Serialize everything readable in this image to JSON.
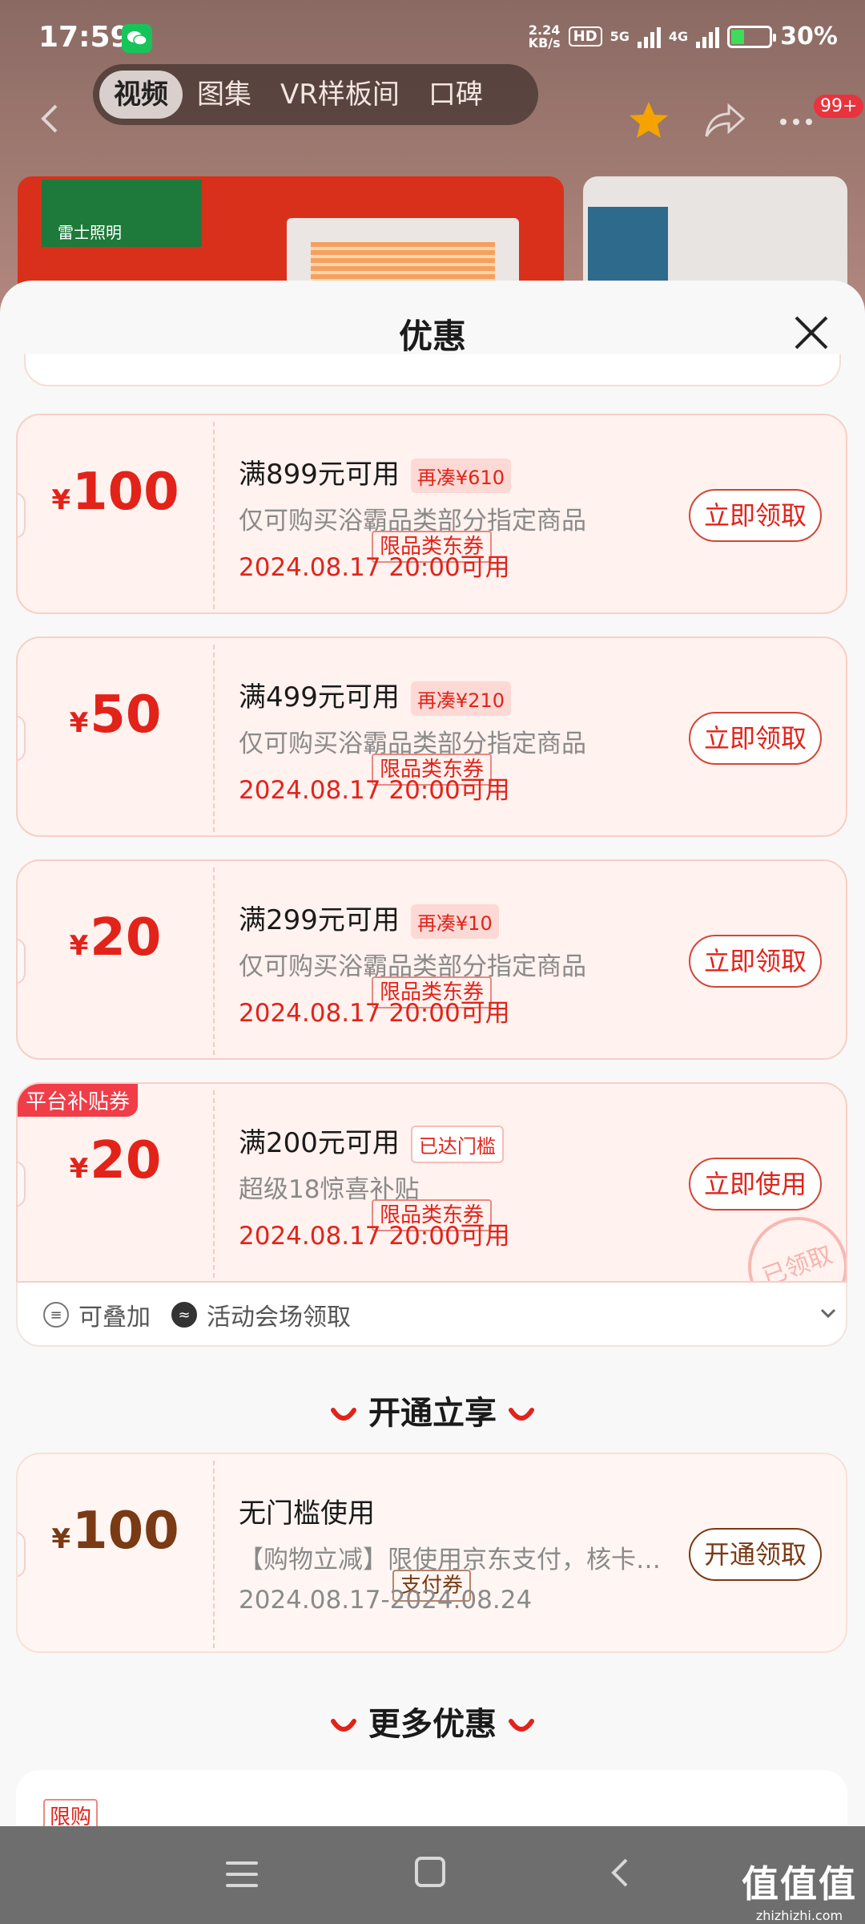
{
  "status_bar": {
    "time": "17:59",
    "net_speed": "2.24",
    "net_unit": "KB/s",
    "hd": "HD",
    "sig1": "5G",
    "sig2": "4G",
    "battery": "30%"
  },
  "header": {
    "tabs": [
      "视频",
      "图集",
      "VR样板间",
      "口碑"
    ],
    "active_tab": 0,
    "badge": "99+"
  },
  "banner": {
    "brand": "雷士照明"
  },
  "sheet": {
    "title": "优惠"
  },
  "coupons": [
    {
      "amount": "100",
      "currency": "¥",
      "type": "限品类东券",
      "title": "满899元可用",
      "badge": "再凑¥610",
      "desc": "仅可购买浴霸品类部分指定商品",
      "date": "2024.08.17 20:00可用",
      "button": "立即领取"
    },
    {
      "amount": "50",
      "currency": "¥",
      "type": "限品类东券",
      "title": "满499元可用",
      "badge": "再凑¥210",
      "desc": "仅可购买浴霸品类部分指定商品",
      "date": "2024.08.17 20:00可用",
      "button": "立即领取"
    },
    {
      "amount": "20",
      "currency": "¥",
      "type": "限品类东券",
      "title": "满299元可用",
      "badge": "再凑¥10",
      "desc": "仅可购买浴霸品类部分指定商品",
      "date": "2024.08.17 20:00可用",
      "button": "立即领取"
    },
    {
      "amount": "20",
      "currency": "¥",
      "type": "限品类东券",
      "title": "满200元可用",
      "badge": "已达门槛",
      "desc": "超级18惊喜补贴",
      "date": "2024.08.17 20:00可用",
      "button": "立即使用",
      "corner_tag": "平台补贴券",
      "stamp": "已领取"
    }
  ],
  "card_footer": {
    "stackable": "可叠加",
    "venue": "活动会场领取"
  },
  "section_open": {
    "title": "开通立享"
  },
  "pay_coupon": {
    "amount": "100",
    "currency": "¥",
    "type": "支付券",
    "title": "无门槛使用",
    "desc": "【购物立减】限使用京东支付，核卡…",
    "date": "2024.08.17-2024.08.24",
    "button": "开通领取"
  },
  "section_more": {
    "title": "更多优惠"
  },
  "more_card": {
    "tag": "限购"
  },
  "watermark": {
    "cn": "值值值",
    "en": "zhizhizhi.com"
  },
  "colors": {
    "accent": "#e2231a",
    "pay_brown": "#7a3a14",
    "card_bg": "#fff2ef"
  }
}
